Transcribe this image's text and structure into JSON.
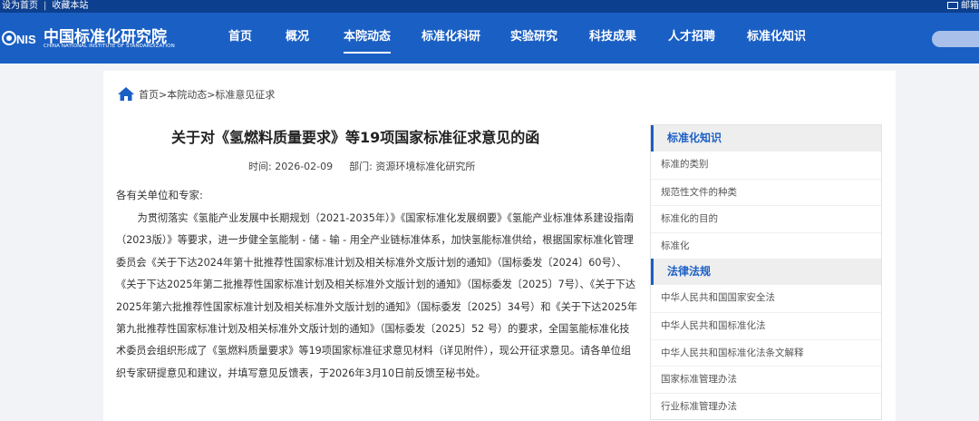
{
  "topbar": {
    "set_home": "设为首页",
    "separator": "|",
    "bookmark": "收藏本站",
    "mail": "邮箱"
  },
  "logo": {
    "mark": "NIS",
    "cn": "中国标准化研究院",
    "en": "CHINA NATIONAL INSTITUTE OF STANDARDIZATION"
  },
  "nav": {
    "items": [
      {
        "label": "首页"
      },
      {
        "label": "概况"
      },
      {
        "label": "本院动态"
      },
      {
        "label": "标准化科研"
      },
      {
        "label": "实验研究"
      },
      {
        "label": "科技成果"
      },
      {
        "label": "人才招聘"
      },
      {
        "label": "标准化知识"
      }
    ],
    "active_index": 2
  },
  "search": {
    "placeholder": ""
  },
  "breadcrumb": "首页>本院动态>标准意见征求",
  "article": {
    "title": "关于对《氢燃料质量要求》等19项国家标准征求意见的函",
    "time_label": "时间:",
    "time_value": "2026-02-09",
    "dept_label": "部门:",
    "dept_value": "资源环境标准化研究所",
    "greeting": "各有关单位和专家:",
    "paragraph": "为贯彻落实《氢能产业发展中长期规划（2021-2035年）》《国家标准化发展纲要》《氢能产业标准体系建设指南（2023版）》等要求，进一步健全氢能制 - 储 - 输 - 用全产业链标准体系，加快氢能标准供给，根据国家标准化管理委员会《关于下达2024年第十批推荐性国家标准计划及相关标准外文版计划的通知》（国标委发〔2024〕60号）、《关于下达2025年第二批推荐性国家标准计划及相关标准外文版计划的通知》（国标委发〔2025〕7号）、《关于下达2025年第六批推荐性国家标准计划及相关标准外文版计划的通知》（国标委发〔2025〕34号）和《关于下达2025年第九批推荐性国家标准计划及相关标准外文版计划的通知》（国标委发〔2025〕52 号）的要求，全国氢能标准化技术委员会组织形成了《氢燃料质量要求》等19项国家标准征求意见材料（详见附件），现公开征求意见。请各单位组织专家研提意见和建议，并填写意见反馈表，于2026年3月10日前反馈至秘书处。"
  },
  "sidebar": {
    "sections": [
      {
        "heading": "标准化知识",
        "items": [
          {
            "label": "标准的类别"
          },
          {
            "label": "规范性文件的种类"
          },
          {
            "label": "标准化的目的"
          },
          {
            "label": "标准化"
          }
        ]
      },
      {
        "heading": "法律法规",
        "items": [
          {
            "label": "中华人民共和国国家安全法"
          },
          {
            "label": "中华人民共和国标准化法"
          },
          {
            "label": "中华人民共和国标准化法条文解释"
          },
          {
            "label": "国家标准管理办法"
          },
          {
            "label": "行业标准管理办法"
          }
        ]
      }
    ]
  },
  "colors": {
    "topbar": "#0d3f8f",
    "header": "#1a5fc4",
    "accent": "#1a5fc4",
    "page_bg": "#f1f3f6"
  },
  "icons": [
    "mail-icon",
    "home-icon",
    "logo-mark"
  ]
}
